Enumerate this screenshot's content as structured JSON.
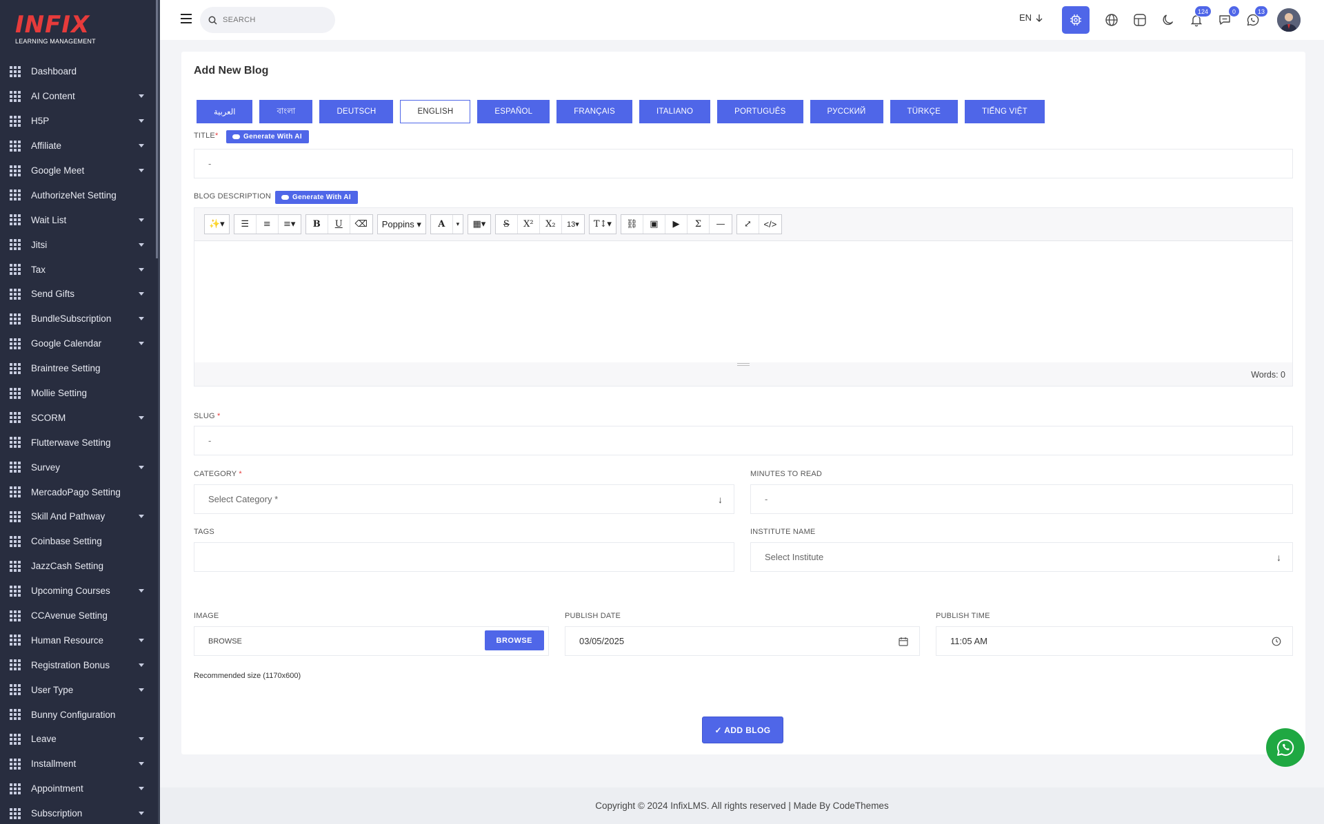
{
  "brand": {
    "name": "INFIX",
    "tagline": "LEARNING MANAGEMENT"
  },
  "sidebar": {
    "items": [
      {
        "label": "Dashboard",
        "has_sub": false
      },
      {
        "label": "AI Content",
        "has_sub": true
      },
      {
        "label": "H5P",
        "has_sub": true
      },
      {
        "label": "Affiliate",
        "has_sub": true
      },
      {
        "label": "Google Meet",
        "has_sub": true
      },
      {
        "label": "AuthorizeNet Setting",
        "has_sub": false
      },
      {
        "label": "Wait List",
        "has_sub": true
      },
      {
        "label": "Jitsi",
        "has_sub": true
      },
      {
        "label": "Tax",
        "has_sub": true
      },
      {
        "label": "Send Gifts",
        "has_sub": true
      },
      {
        "label": "BundleSubscription",
        "has_sub": true
      },
      {
        "label": "Google Calendar",
        "has_sub": true
      },
      {
        "label": "Braintree Setting",
        "has_sub": false
      },
      {
        "label": "Mollie Setting",
        "has_sub": false
      },
      {
        "label": "SCORM",
        "has_sub": true
      },
      {
        "label": "Flutterwave Setting",
        "has_sub": false
      },
      {
        "label": "Survey",
        "has_sub": true
      },
      {
        "label": "MercadoPago Setting",
        "has_sub": false
      },
      {
        "label": "Skill And Pathway",
        "has_sub": true
      },
      {
        "label": "Coinbase Setting",
        "has_sub": false
      },
      {
        "label": "JazzCash Setting",
        "has_sub": false
      },
      {
        "label": "Upcoming Courses",
        "has_sub": true
      },
      {
        "label": "CCAvenue Setting",
        "has_sub": false
      },
      {
        "label": "Human Resource",
        "has_sub": true
      },
      {
        "label": "Registration Bonus",
        "has_sub": true
      },
      {
        "label": "User Type",
        "has_sub": true
      },
      {
        "label": "Bunny Configuration",
        "has_sub": false
      },
      {
        "label": "Leave",
        "has_sub": true
      },
      {
        "label": "Installment",
        "has_sub": true
      },
      {
        "label": "Appointment",
        "has_sub": true
      },
      {
        "label": "Subscription",
        "has_sub": true
      }
    ]
  },
  "header": {
    "search_placeholder": "SEARCH",
    "language": "EN",
    "notifications_count": "124",
    "messages_count": "0",
    "chat_count": "13"
  },
  "form": {
    "title": "Add New Blog",
    "languages": [
      "العربية",
      "বাংলা",
      "DEUTSCH",
      "ENGLISH",
      "ESPAÑOL",
      "FRANÇAIS",
      "ITALIANO",
      "PORTUGUÊS",
      "РУССКИЙ",
      "TÜRKÇE",
      "TIẾNG VIỆT"
    ],
    "selected_language": "ENGLISH",
    "generate_ai_label": "Generate With AI",
    "title_label": "TITLE",
    "title_placeholder": "-",
    "description_label": "BLOG DESCRIPTION",
    "editor": {
      "font_name": "Poppins",
      "font_size": "13",
      "word_count": "Words: 0"
    },
    "slug_label": "SLUG",
    "slug_placeholder": "-",
    "category_label": "CATEGORY",
    "category_placeholder": "Select Category *",
    "minutes_label": "MINUTES TO READ",
    "minutes_placeholder": "-",
    "tags_label": "TAGS",
    "institute_label": "INSTITUTE NAME",
    "institute_placeholder": "Select Institute",
    "image_label": "IMAGE",
    "image_placeholder": "BROWSE",
    "browse_label": "BROWSE",
    "recommended_size": "Recommended size (1170x600)",
    "publish_date_label": "PUBLISH DATE",
    "publish_date": "03/05/2025",
    "publish_time_label": "PUBLISH TIME",
    "publish_time": "11:05 AM",
    "submit_label": "✓ ADD BLOG"
  },
  "footer": {
    "text": "Copyright © 2024 InfixLMS. All rights reserved | Made By CodeThemes"
  },
  "colors": {
    "accent": "#4f66e8",
    "sidebar_bg": "#282d3f",
    "logo_red": "#e63b3b",
    "whatsapp": "#1fa842"
  }
}
